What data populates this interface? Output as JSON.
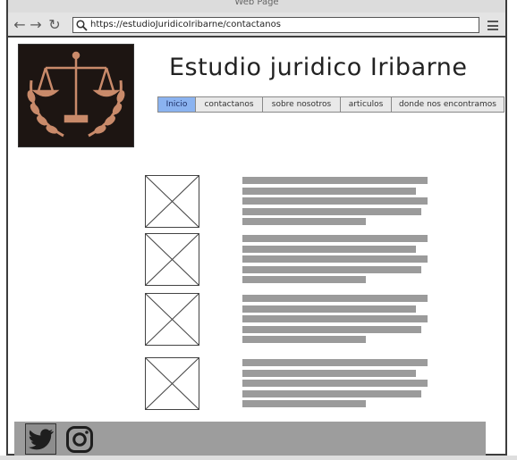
{
  "window": {
    "title": "Web Page"
  },
  "browser": {
    "url": "https://estudioJuridicoIribarne/contactanos"
  },
  "site": {
    "title": "Estudio juridico Iribarne"
  },
  "nav": {
    "items": [
      "Inicio",
      "contactanos",
      "sobre nosotros",
      "articulos",
      "donde nos encontramos"
    ],
    "active": "Inicio"
  },
  "icons": {
    "back": "arrow-left-icon",
    "forward": "arrow-right-icon",
    "reload": "reload-icon",
    "search": "search-icon",
    "menu": "hamburger-menu-icon",
    "twitter": "twitter-icon",
    "instagram": "instagram-icon",
    "logo": "scales-of-justice-logo"
  },
  "colors": {
    "active_tab": "#8bb3f0",
    "placeholder_text": "#9b9b9b",
    "footer": "#9d9d9d"
  }
}
